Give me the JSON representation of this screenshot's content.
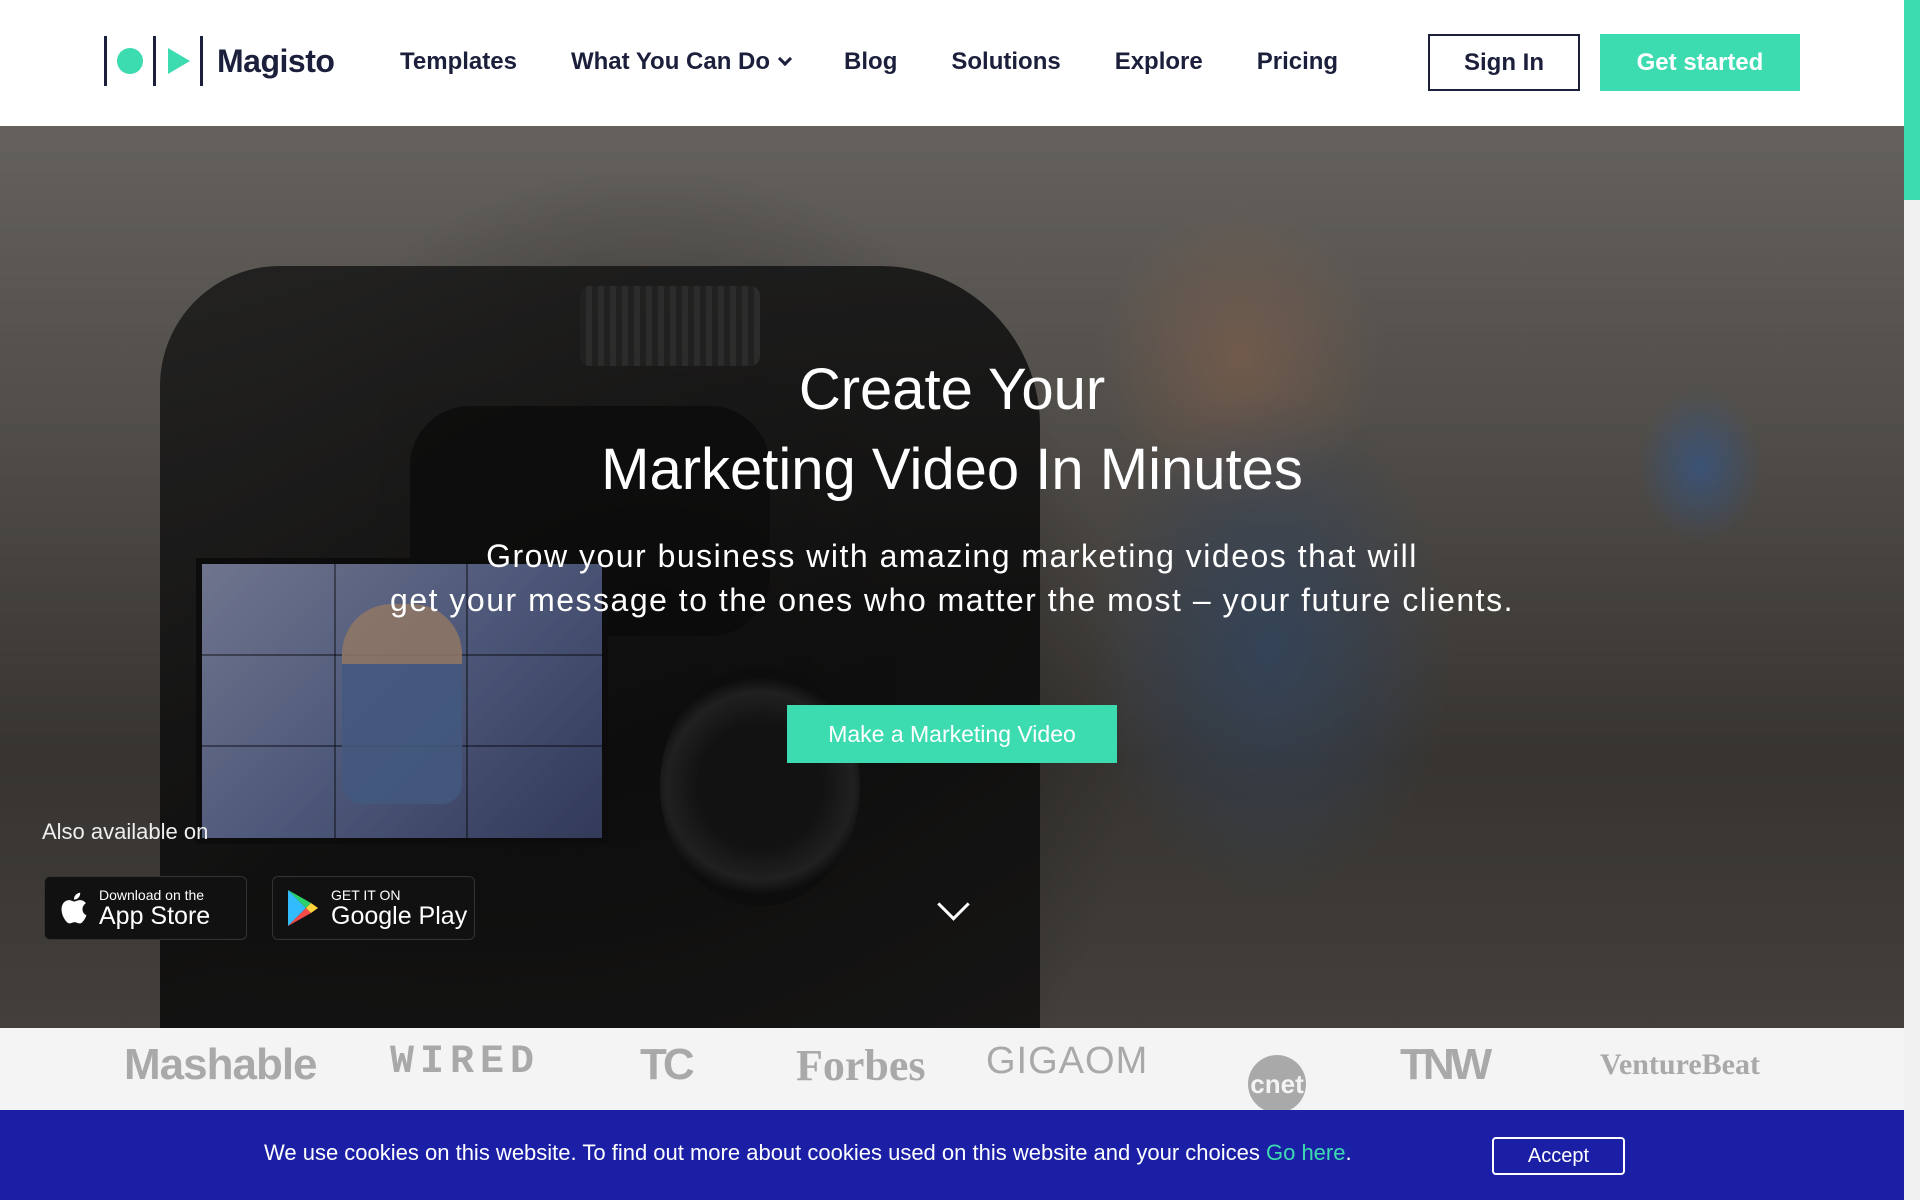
{
  "header": {
    "brand": "Magisto",
    "nav": [
      "Templates",
      "What You Can Do",
      "Blog",
      "Solutions",
      "Explore",
      "Pricing"
    ],
    "sign_in": "Sign In",
    "get_started": "Get started"
  },
  "hero": {
    "title_line1": "Create Your",
    "title_line2": "Marketing Video In Minutes",
    "subtitle_line1": "Grow your business with amazing marketing videos that will",
    "subtitle_line2": "get your message to the ones who matter the most – your future clients.",
    "cta": "Make a Marketing Video",
    "also_available": "Also available on",
    "app_store": {
      "small": "Download on the",
      "big": "App Store"
    },
    "google_play": {
      "small": "GET IT ON",
      "big": "Google Play"
    }
  },
  "press": [
    "Mashable",
    "WIRED",
    "TC",
    "Forbes",
    "GIGAOM",
    "cnet",
    "TNW",
    "VentureBeat"
  ],
  "cookie": {
    "text": "We use cookies on this website. To find out more about cookies used on this website and your choices ",
    "link": "Go here",
    "end": ".",
    "accept": "Accept"
  },
  "colors": {
    "accent": "#3ddbb0",
    "navy": "#1b1f3b",
    "cookie_bg": "#1a1fa6"
  }
}
